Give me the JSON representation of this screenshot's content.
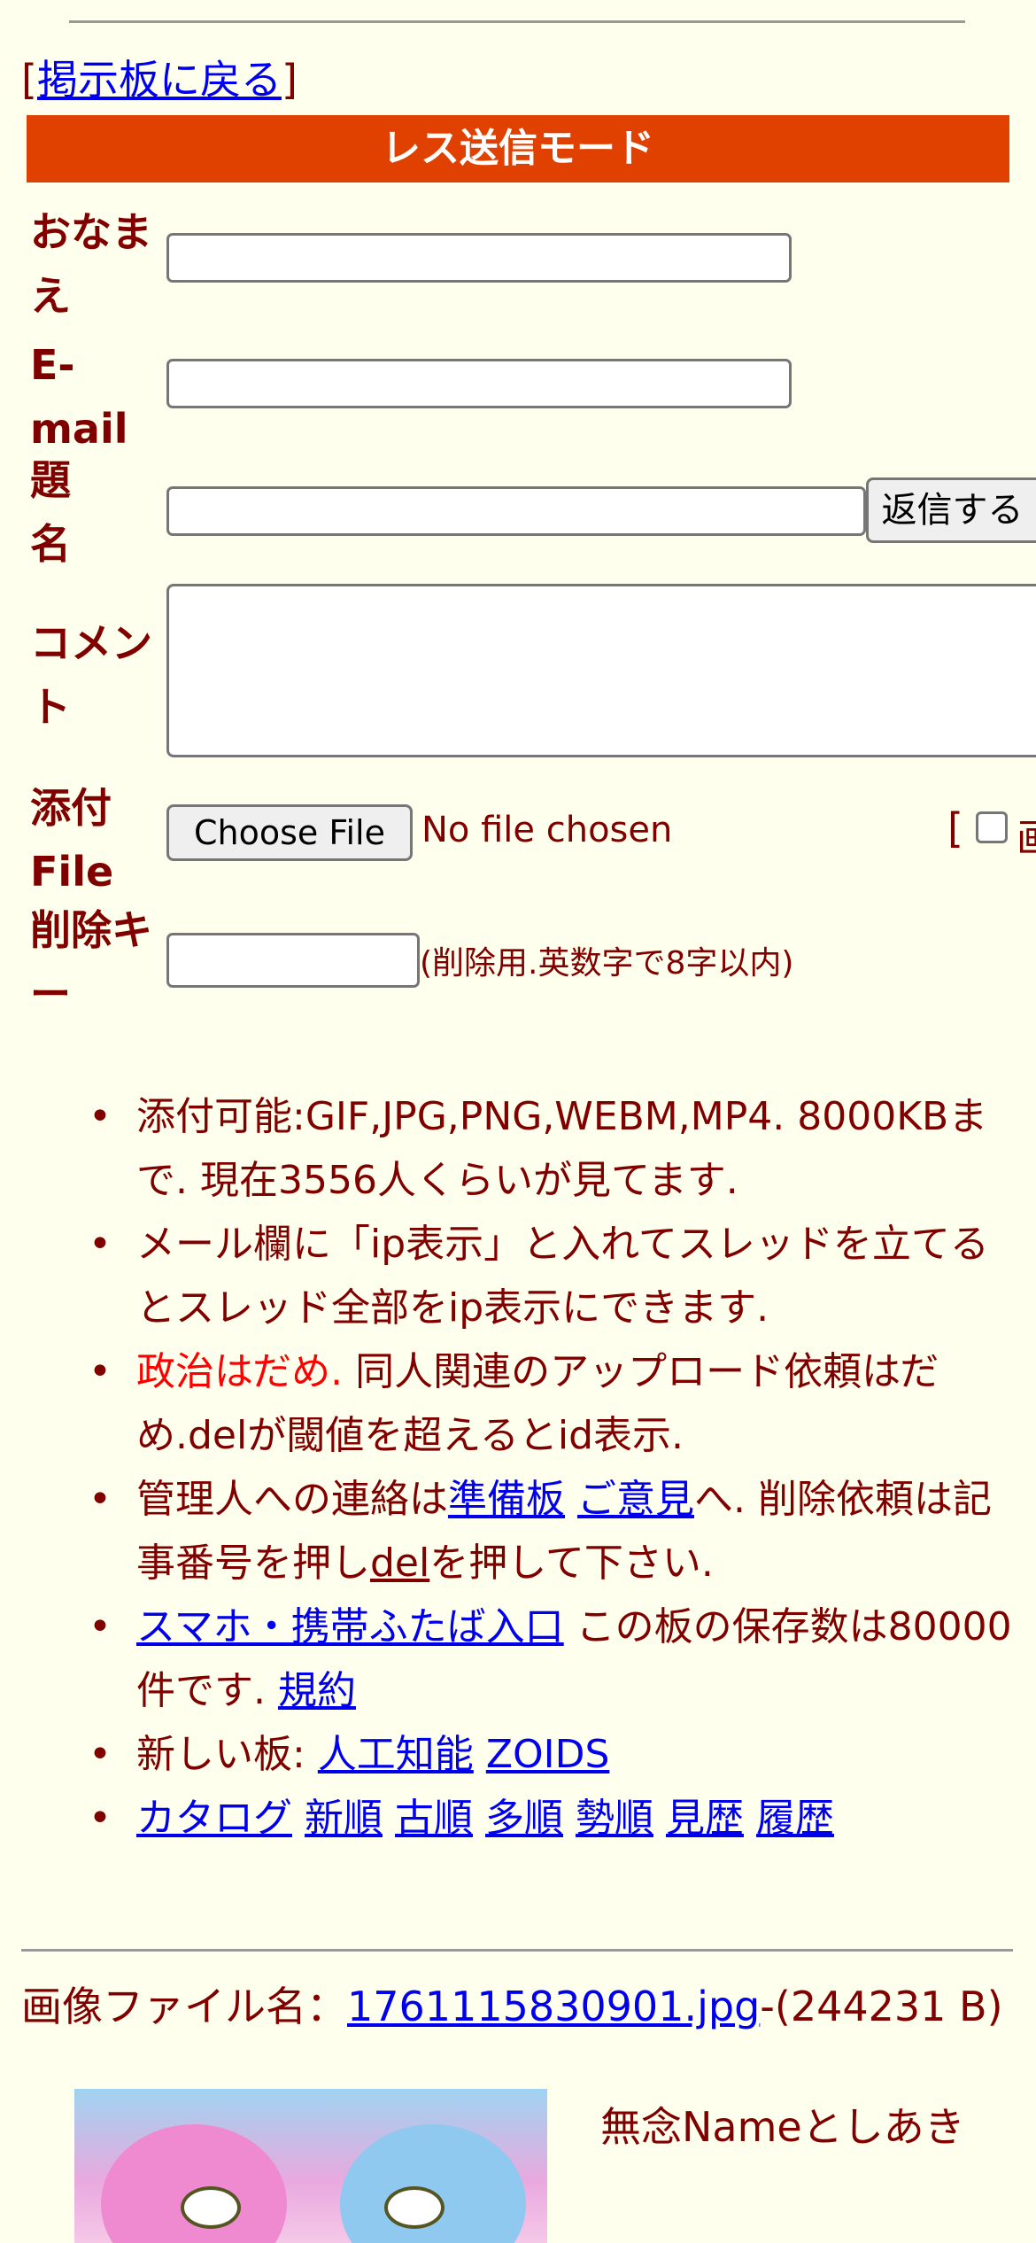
{
  "back_link": {
    "prefix": "[",
    "label": "掲示板に戻る",
    "suffix": "]"
  },
  "mode_title": "レス送信モード",
  "form": {
    "name_label": "おなまえ",
    "email_label": "E-mail",
    "subject_label": "題名",
    "comment_label": "コメント",
    "file_label": "添付File",
    "delkey_label": "削除キー",
    "reply_button": "返信する",
    "choose_file_button": "Choose File",
    "no_file_text": "No file chosen",
    "image_checkbox_prefix": "[",
    "image_checkbox_label": "画",
    "delkey_note": "(削除用.英数字で8字以内)"
  },
  "notes": {
    "n1": "添付可能:GIF,JPG,PNG,WEBM,MP4. 8000KBまで. 現在3556人くらいが見てます.",
    "n2": "メール欄に「ip表示」と入れてスレッドを立てるとスレッド全部をip表示にできます.",
    "n3_red": "政治はだめ.",
    "n3_rest": " 同人関連のアップロード依頼はだめ.delが閾値を超えるとid表示.",
    "n4_a": "管理人への連絡は",
    "n4_link1": "準備板",
    "n4_link2": "ご意見",
    "n4_b": "へ. 削除依頼は記事番号を押し",
    "n4_del": "del",
    "n4_c": "を押して下さい.",
    "n5_link": "スマホ・携帯ふたば入口",
    "n5_text": " この板の保存数は80000件です. ",
    "n5_rules": "規約",
    "n6_prefix": "新しい板: ",
    "n6_link1": "人工知能",
    "n6_link2": "ZOIDS",
    "sort_links": [
      "カタログ",
      "新順",
      "古順",
      "多順",
      "勢順",
      "見歴",
      "履歴"
    ]
  },
  "post": {
    "file_label": "画像ファイル名：",
    "file_name": "1761115830901.jpg",
    "file_size": "-(244231 B)",
    "poster_line": "無念Nameとしあき"
  }
}
